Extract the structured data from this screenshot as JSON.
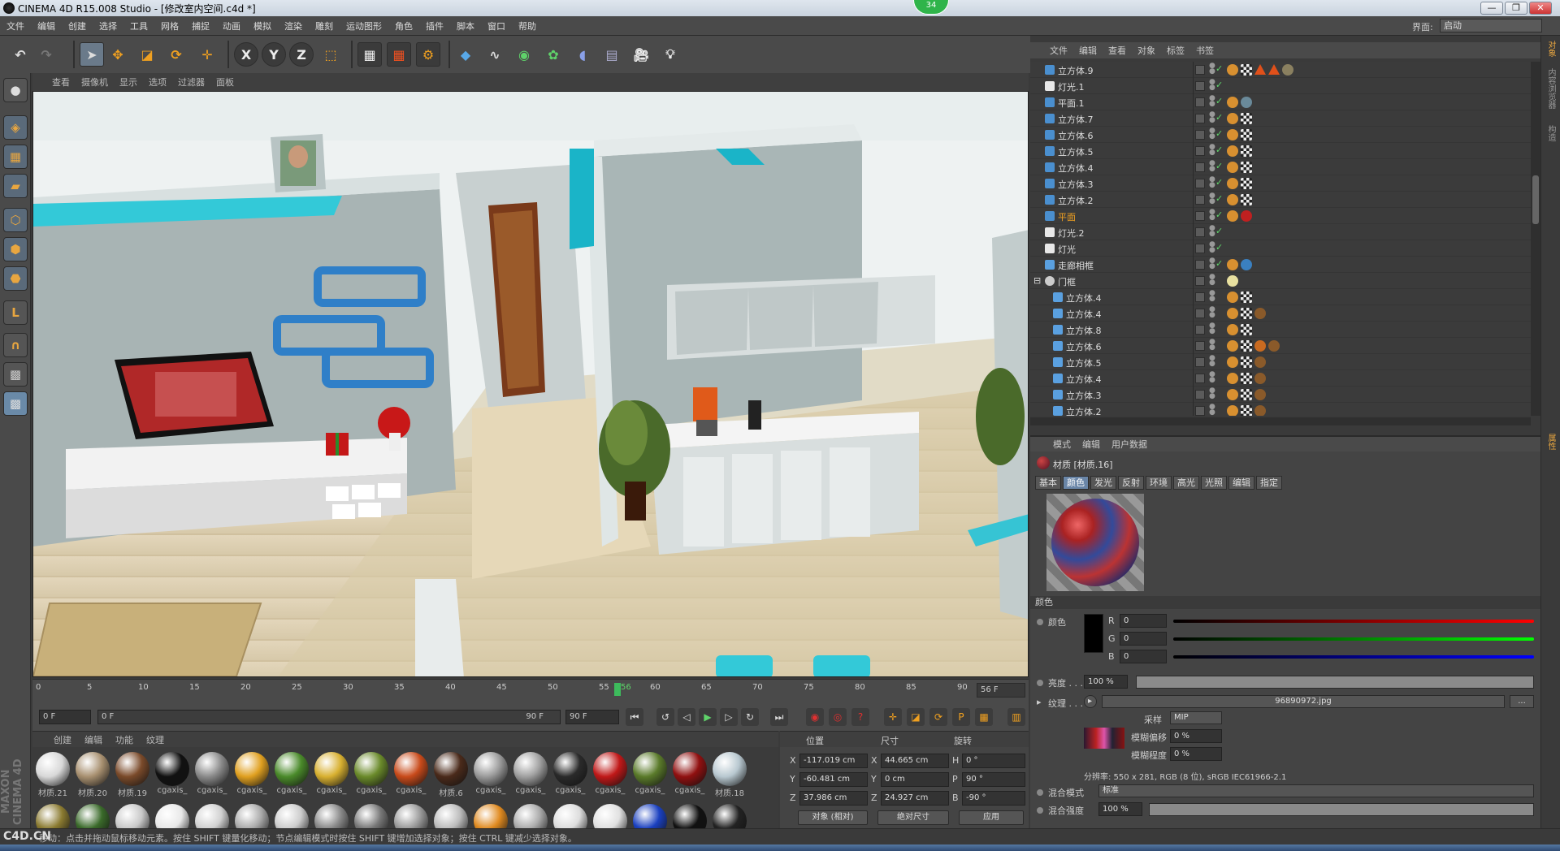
{
  "window": {
    "title": "CINEMA 4D R15.008 Studio - [修改室内空间.c4d *]",
    "badge": "34",
    "buttons": [
      "—",
      "❐",
      "✕"
    ]
  },
  "menubar": {
    "items": [
      "文件",
      "编辑",
      "创建",
      "选择",
      "工具",
      "网格",
      "捕捉",
      "动画",
      "模拟",
      "渲染",
      "雕刻",
      "运动图形",
      "角色",
      "插件",
      "脚本",
      "窗口",
      "帮助"
    ],
    "interface_label": "界面:",
    "interface_value": "启动"
  },
  "toolbar": {
    "axis_x": "X",
    "axis_y": "Y",
    "axis_z": "Z"
  },
  "viewport": {
    "menu": [
      "查看",
      "摄像机",
      "显示",
      "选项",
      "过滤器",
      "面板"
    ]
  },
  "timeline": {
    "ticks": [
      "0",
      "5",
      "10",
      "15",
      "20",
      "25",
      "30",
      "35",
      "40",
      "45",
      "50",
      "55",
      "60",
      "65",
      "70",
      "75",
      "80",
      "85",
      "90"
    ],
    "playhead_frame": "56",
    "current_frame": "56 F",
    "start_field": "0 F",
    "range_start": "0 F",
    "range_end": "90 F",
    "end_field": "90 F"
  },
  "materials": {
    "menu": [
      "创建",
      "编辑",
      "功能",
      "纹理"
    ],
    "items": [
      {
        "label": "材质.21",
        "color": "#d8d8d8"
      },
      {
        "label": "材质.20",
        "color": "#a89070"
      },
      {
        "label": "材质.19",
        "color": "#7a4a2a"
      },
      {
        "label": "cgaxis_",
        "color": "#111111"
      },
      {
        "label": "cgaxis_",
        "color": "#8a8a8a"
      },
      {
        "label": "cgaxis_",
        "color": "#e0a020"
      },
      {
        "label": "cgaxis_",
        "color": "#4a8a2a"
      },
      {
        "label": "cgaxis_",
        "color": "#d8b030"
      },
      {
        "label": "cgaxis_",
        "color": "#6a8a2a"
      },
      {
        "label": "cgaxis_",
        "color": "#c84a1a"
      },
      {
        "label": "材质.6",
        "color": "#4a2a1a"
      },
      {
        "label": "cgaxis_",
        "color": "#9a9a9a"
      },
      {
        "label": "cgaxis_",
        "color": "#a0a0a0"
      },
      {
        "label": "cgaxis_",
        "color": "#2a2a2a"
      },
      {
        "label": "cgaxis_",
        "color": "#c01818"
      },
      {
        "label": "cgaxis_",
        "color": "#5a7a2a"
      },
      {
        "label": "cgaxis_",
        "color": "#901010"
      },
      {
        "label": "材质.18",
        "color": "#b8c8d0"
      }
    ],
    "row2_colors": [
      "#8a7a30",
      "#3a6a2a",
      "#c8c8c8",
      "#e8e8e8",
      "#d0d0d0",
      "#aaaaaa",
      "#cccccc",
      "#888888",
      "#777777",
      "#999999",
      "#bbbbbb",
      "#e08a20",
      "#aaaaaa",
      "#dddddd",
      "#e0e0e0",
      "#1a40c0",
      "#111111",
      "#222222"
    ]
  },
  "coords": {
    "headers": {
      "position": "位置",
      "size": "尺寸",
      "rotation": "旋转"
    },
    "rows": [
      {
        "axis": "X",
        "pos": "-117.019 cm",
        "size_axis": "X",
        "size": "44.665 cm",
        "rot_axis": "H",
        "rot": "0 °"
      },
      {
        "axis": "Y",
        "pos": "-60.481 cm",
        "size_axis": "Y",
        "size": "0 cm",
        "rot_axis": "P",
        "rot": "90 °"
      },
      {
        "axis": "Z",
        "pos": "37.986 cm",
        "size_axis": "Z",
        "size": "24.927 cm",
        "rot_axis": "B",
        "rot": "-90 °"
      }
    ],
    "mode_left": "对象 (相对)",
    "mode_right": "绝对尺寸",
    "apply": "应用"
  },
  "objects": {
    "menu": [
      "文件",
      "编辑",
      "查看",
      "对象",
      "标签",
      "书签"
    ],
    "rows": [
      {
        "name": "立方体.9",
        "indent": 0,
        "type": "cube",
        "tags": [
          "#d89030",
          "#cccccc",
          "#e0501a",
          "#e0501a",
          "#8a8060"
        ]
      },
      {
        "name": "灯光.1",
        "indent": 0,
        "type": "light",
        "tags": []
      },
      {
        "name": "平面.1",
        "indent": 0,
        "type": "plane",
        "tags": [
          "#d89030",
          "#6a8a9a"
        ]
      },
      {
        "name": "立方体.7",
        "indent": 0,
        "type": "cube",
        "tags": [
          "#d89030",
          "#cccccc"
        ]
      },
      {
        "name": "立方体.6",
        "indent": 0,
        "type": "cube",
        "tags": [
          "#d89030",
          "#cccccc"
        ]
      },
      {
        "name": "立方体.5",
        "indent": 0,
        "type": "cube",
        "tags": [
          "#d89030",
          "#cccccc"
        ]
      },
      {
        "name": "立方体.4",
        "indent": 0,
        "type": "cube",
        "tags": [
          "#d89030",
          "#cccccc"
        ]
      },
      {
        "name": "立方体.3",
        "indent": 0,
        "type": "cube",
        "tags": [
          "#d89030",
          "#cccccc"
        ]
      },
      {
        "name": "立方体.2",
        "indent": 0,
        "type": "cube",
        "tags": [
          "#d89030",
          "#cccccc"
        ]
      },
      {
        "name": "平面",
        "indent": 0,
        "type": "plane",
        "tags": [
          "#d89030",
          "#c02020"
        ],
        "highlight": true
      },
      {
        "name": "灯光.2",
        "indent": 0,
        "type": "light",
        "tags": []
      },
      {
        "name": "灯光",
        "indent": 0,
        "type": "light",
        "tags": []
      },
      {
        "name": "走廊相框",
        "indent": 0,
        "type": "poly",
        "tags": [
          "#d89030",
          "#3a80c0"
        ]
      },
      {
        "name": "门框",
        "indent": 0,
        "type": "null",
        "tags": [
          "#e8e0a0"
        ]
      },
      {
        "name": "立方体.4",
        "indent": 1,
        "type": "poly",
        "tags": [
          "#d89030",
          "#cccccc"
        ]
      },
      {
        "name": "立方体.4",
        "indent": 1,
        "type": "poly",
        "tags": [
          "#d89030",
          "#cccccc",
          "#8a5a2a"
        ]
      },
      {
        "name": "立方体.8",
        "indent": 1,
        "type": "poly",
        "tags": [
          "#d89030",
          "#cccccc"
        ]
      },
      {
        "name": "立方体.6",
        "indent": 1,
        "type": "poly",
        "tags": [
          "#d89030",
          "#cccccc",
          "#c86a20",
          "#8a5a2a"
        ]
      },
      {
        "name": "立方体.5",
        "indent": 1,
        "type": "poly",
        "tags": [
          "#d89030",
          "#cccccc",
          "#8a5a2a"
        ]
      },
      {
        "name": "立方体.4",
        "indent": 1,
        "type": "poly",
        "tags": [
          "#d89030",
          "#cccccc",
          "#8a5a2a"
        ]
      },
      {
        "name": "立方体.3",
        "indent": 1,
        "type": "poly",
        "tags": [
          "#d89030",
          "#cccccc",
          "#8a5a2a"
        ]
      },
      {
        "name": "立方体.2",
        "indent": 1,
        "type": "poly",
        "tags": [
          "#d89030",
          "#cccccc",
          "#8a5a2a"
        ]
      }
    ]
  },
  "attributes": {
    "menu": [
      "模式",
      "编辑",
      "用户数据"
    ],
    "material_title": "材质 [材质.16]",
    "tabs": [
      "基本",
      "颜色",
      "发光",
      "反射",
      "环境",
      "高光",
      "光照",
      "编辑",
      "指定"
    ],
    "active_tab": "颜色",
    "section": "颜色",
    "color_label": "颜色",
    "r_label": "R",
    "r": "0",
    "g_label": "G",
    "g": "0",
    "b_label": "B",
    "b": "0",
    "brightness_label": "亮度 . . .",
    "brightness": "100 %",
    "texture_label": "纹理 . . .",
    "texture_file": "96890972.jpg",
    "texture_more": "...",
    "sampling_label": "采样",
    "sampling": "MIP",
    "blur_offset_label": "模糊偏移",
    "blur_offset": "0 %",
    "blur_scale_label": "模糊程度",
    "blur_scale": "0 %",
    "resolution": "分辨率: 550 x 281, RGB (8 位), sRGB IEC61966-2.1",
    "blend_mode_label": "混合模式",
    "blend_mode": "标准",
    "blend_strength_label": "混合强度",
    "blend_strength": "100 %"
  },
  "status": {
    "text": "移动：点击并拖动鼠标移动元素。按住 SHIFT 键量化移动；节点编辑模式时按住 SHIFT 键增加选择对象；按住 CTRL 键减少选择对象。",
    "watermark": "C4D.CN",
    "maxon": "MAXON CINEMA 4D"
  },
  "rightstrip": [
    "对象",
    "内容浏览器",
    "构造",
    "属性"
  ]
}
